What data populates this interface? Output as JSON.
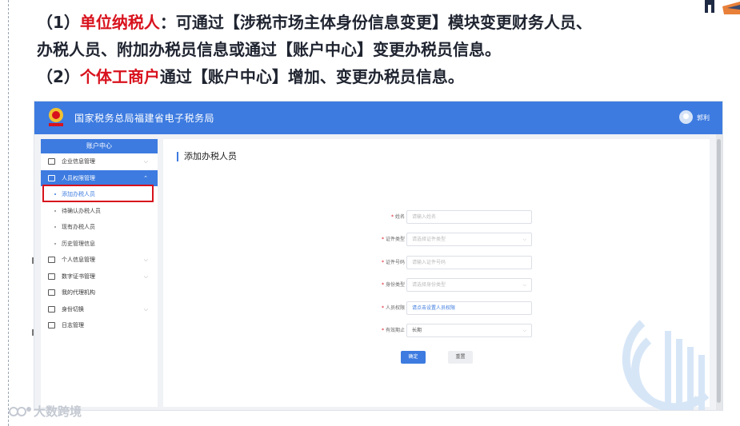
{
  "heading": {
    "line1_prefix": "（1）",
    "line1_highlight": "单位纳税人",
    "line1_rest": "：可通过【涉税市场主体身份信息变更】模块变更财务人员、",
    "line2": "办税人员、附加办税员信息或通过【账户中心】变更办税员信息。",
    "line3_prefix": "（2）",
    "line3_highlight": "个体工商户",
    "line3_rest": "通过【账户中心】增加、变更办税员信息。",
    "highlight_color": "#d8121d"
  },
  "app": {
    "title": "国家税务总局福建省电子税务局",
    "user_name": "郭利",
    "accent_color": "#3d7be0"
  },
  "sidebar": {
    "header": "账户中心",
    "items": [
      {
        "label": "企业信息管理",
        "icon": "building-icon",
        "expand": "⌵"
      },
      {
        "label": "人员权限管理",
        "icon": "people-icon",
        "expand": "⌃"
      }
    ],
    "sub_items": [
      {
        "label": "添加办税人员"
      },
      {
        "label": "待确认办税人员"
      },
      {
        "label": "现有办税人员"
      },
      {
        "label": "历史管理信息"
      }
    ],
    "more_items": [
      {
        "label": "个人信息管理",
        "icon": "id-card-icon",
        "expand": "⌵"
      },
      {
        "label": "数字证书管理",
        "icon": "certificate-icon",
        "expand": "⌵"
      },
      {
        "label": "我的代理机构",
        "icon": "agency-icon",
        "expand": ""
      },
      {
        "label": "身份切换",
        "icon": "switch-icon",
        "expand": "⌵"
      },
      {
        "label": "日志管理",
        "icon": "log-icon",
        "expand": ""
      }
    ]
  },
  "main": {
    "title": "添加办税人员",
    "fields": [
      {
        "label": "姓名",
        "placeholder": "请输入姓名"
      },
      {
        "label": "证件类型",
        "placeholder": "请选择证件类型"
      },
      {
        "label": "证件号码",
        "placeholder": "请输入证件号码"
      },
      {
        "label": "身份类型",
        "placeholder": "请选择身份类型"
      },
      {
        "label": "人员权限",
        "placeholder": "请点击设置人员权限"
      },
      {
        "label": "有效期止",
        "placeholder": "长期"
      }
    ],
    "confirm": "确定",
    "reset": "重置"
  },
  "brand": {
    "name": "大数跨境"
  }
}
